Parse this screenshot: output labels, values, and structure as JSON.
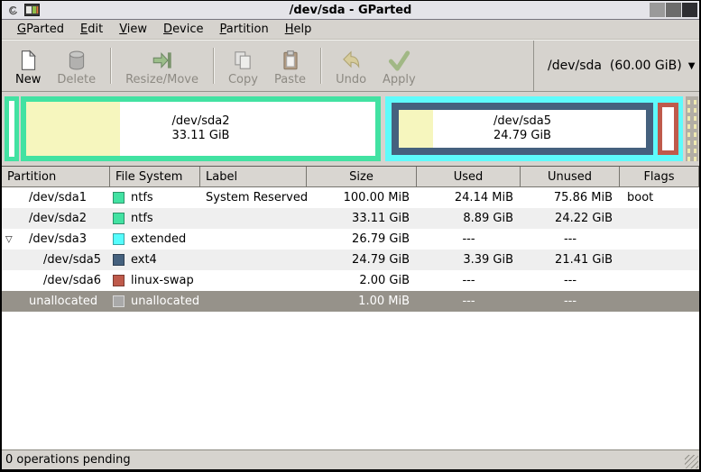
{
  "window": {
    "title": "/dev/sda - GParted"
  },
  "menu": {
    "items": [
      {
        "head": "G",
        "rest": "Parted"
      },
      {
        "head": "E",
        "rest": "dit"
      },
      {
        "head": "V",
        "rest": "iew"
      },
      {
        "head": "D",
        "rest": "evice"
      },
      {
        "head": "P",
        "rest": "artition"
      },
      {
        "head": "H",
        "rest": "elp"
      }
    ]
  },
  "toolbar": {
    "buttons": [
      {
        "label": "New",
        "enabled": true
      },
      {
        "label": "Delete",
        "enabled": false
      },
      {
        "label": "Resize/Move",
        "enabled": false
      },
      {
        "label": "Copy",
        "enabled": false
      },
      {
        "label": "Paste",
        "enabled": false
      },
      {
        "label": "Undo",
        "enabled": false
      },
      {
        "label": "Apply",
        "enabled": false
      }
    ],
    "device_selector": {
      "value": "/dev/sda  (60.00 GiB)"
    }
  },
  "disk_visual": {
    "sda2": {
      "name": "/dev/sda2",
      "size": "33.11 GiB"
    },
    "sda5": {
      "name": "/dev/sda5",
      "size": "24.79 GiB"
    }
  },
  "table": {
    "columns": [
      "Partition",
      "File System",
      "Label",
      "Size",
      "Used",
      "Unused",
      "Flags"
    ],
    "rows": [
      {
        "partition": "/dev/sda1",
        "filesystem": "ntfs",
        "label": "System Reserved",
        "size": "100.00 MiB",
        "used": "24.14 MiB",
        "unused": "75.86 MiB",
        "flags": "boot",
        "selected": false
      },
      {
        "partition": "/dev/sda2",
        "filesystem": "ntfs",
        "label": "",
        "size": "33.11 GiB",
        "used": "8.89 GiB",
        "unused": "24.22 GiB",
        "flags": "",
        "selected": false
      },
      {
        "partition": "/dev/sda3",
        "filesystem": "extended",
        "label": "",
        "size": "26.79 GiB",
        "used": "---",
        "unused": "---",
        "flags": "",
        "expanded": true,
        "selected": false
      },
      {
        "partition": "/dev/sda5",
        "filesystem": "ext4",
        "label": "",
        "size": "24.79 GiB",
        "used": "3.39 GiB",
        "unused": "21.41 GiB",
        "flags": "",
        "selected": false
      },
      {
        "partition": "/dev/sda6",
        "filesystem": "linux-swap",
        "label": "",
        "size": "2.00 GiB",
        "used": "---",
        "unused": "---",
        "flags": "",
        "selected": false
      },
      {
        "partition": "unallocated",
        "filesystem": "unallocated",
        "label": "",
        "size": "1.00 MiB",
        "used": "---",
        "unused": "---",
        "flags": "",
        "selected": true
      }
    ]
  },
  "status_bar": {
    "text": "0 operations pending"
  },
  "icons": {
    "expander": "▽",
    "dropdown": "▼"
  },
  "colors": {
    "ntfs": "#42e2a2",
    "extended": "#55fdfd",
    "ext4": "#45617e",
    "linux_swap": "#bf5a4b",
    "unallocated": "#a9a9a9",
    "used_space": "#f6f6be",
    "selected_row_bg": "#96928a",
    "toolbar_bg": "#d6d3ce"
  }
}
